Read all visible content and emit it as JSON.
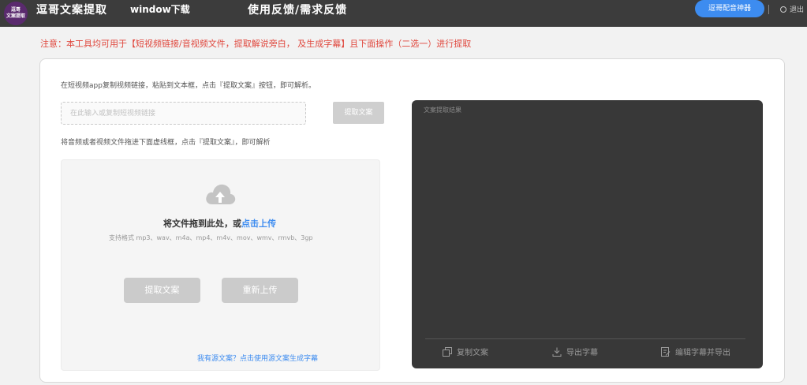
{
  "header": {
    "logo_text": "逗哥\n文案提取",
    "title": "逗哥文案提取",
    "nav_download": "window下载",
    "nav_feedback": "使用反馈/需求反馈",
    "pill_button": "逗哥配音神器",
    "logout": "退出"
  },
  "notice": "注意：本工具均可用于【短视频链接/音视频文件，提取解说旁白， 及生成字幕】且下面操作（二选一）进行提取",
  "url_section": {
    "hint": "在短视频app复制视频链接，粘贴到文本框，点击『提取文案』按钮，即可解析。",
    "placeholder": "在此输入或复制短视频链接",
    "extract_button": "提取文案"
  },
  "file_section": {
    "hint": "将音频或者视频文件拖进下面虚线框，点击『提取文案』，即可解析",
    "drop_text_prefix": "将文件拖到此处，或",
    "drop_text_link": "点击上传",
    "formats": "支持格式 mp3、wav、m4a、mp4、m4v、mov、wmv、rmvb、3gp",
    "extract_button": "提取文案",
    "reupload_button": "重新上传",
    "source_link": "我有源文案？点击使用源文案生成字幕"
  },
  "result": {
    "title": "文案提取结果",
    "copy": "复制文案",
    "export": "导出字幕",
    "edit_export": "编辑字幕并导出"
  },
  "colors": {
    "topbar": "#3c3c3c",
    "accent": "#3d8cf0",
    "notice": "#e0473d",
    "result_bg": "#383838"
  }
}
